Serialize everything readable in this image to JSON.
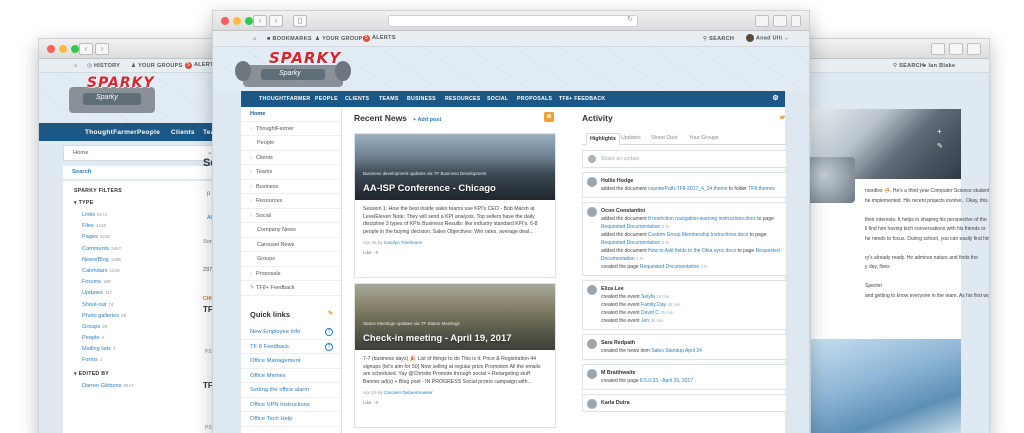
{
  "left_window": {
    "topbar": {
      "history": "HISTORY",
      "your_groups": "YOUR GROUPS",
      "alerts": "ALERTS",
      "alerts_count": "5"
    },
    "logo": {
      "title": "SPARKY",
      "subtitle": "Sparky"
    },
    "nav": [
      "ThoughtFarmer",
      "People",
      "Clients",
      "Tea"
    ],
    "home_dropdown": "Home",
    "search": "Search",
    "filters_title": "SPARKY FILTERS",
    "type_title": "TYPE",
    "filters": [
      {
        "label": "Links",
        "count": "8171"
      },
      {
        "label": "Files",
        "count": "4148"
      },
      {
        "label": "Pages",
        "count": "3232"
      },
      {
        "label": "Comments",
        "count": "2457"
      },
      {
        "label": "News/Blog",
        "count": "1385"
      },
      {
        "label": "Calendars",
        "count": "1249"
      },
      {
        "label": "Forums",
        "count": "188"
      },
      {
        "label": "Updates",
        "count": "117"
      },
      {
        "label": "Shout-out",
        "count": "74"
      },
      {
        "label": "Photo galleries",
        "count": "59"
      },
      {
        "label": "Groups",
        "count": "28"
      },
      {
        "label": "People",
        "count": "4"
      },
      {
        "label": "Mailing lists",
        "count": "3"
      },
      {
        "label": "Forms",
        "count": "1"
      }
    ],
    "edited_by_title": "EDITED BY",
    "edited_by": {
      "label": "Darren Gibbons",
      "count": "8517"
    },
    "partial": {
      "se": "Se",
      "p": "p",
      "all": "All",
      "sort": "Sort",
      "num": "237",
      "chi": "CHI",
      "tf1": "TF",
      "tf2": "TF",
      "ps": "PS"
    }
  },
  "main_window": {
    "topbar": {
      "bookmarks": "BOOKMARKS",
      "your_groups": "YOUR GROUPS",
      "alerts": "ALERTS",
      "alerts_count": "5",
      "search": "SEARCH",
      "user": "Anad Ulli"
    },
    "logo": {
      "title": "SPARKY",
      "subtitle": "Sparky"
    },
    "nav": [
      "THOUGHTFARMER",
      "PEOPLE",
      "CLIENTS",
      "TEAMS",
      "BUSINESS",
      "RESOURCES",
      "SOCIAL",
      "PROPOSALS",
      "TF8+ FEEDBACK"
    ],
    "menu": [
      {
        "label": "Home",
        "level": 0,
        "chev": "",
        "active": true
      },
      {
        "label": "ThoughtFarmer",
        "level": 0,
        "chev": "›"
      },
      {
        "label": "People",
        "level": 1,
        "chev": ""
      },
      {
        "label": "Clients",
        "level": 0,
        "chev": "›"
      },
      {
        "label": "Teams",
        "level": 0,
        "chev": "›"
      },
      {
        "label": "Business",
        "level": 0,
        "chev": "›"
      },
      {
        "label": "Resources",
        "level": 0,
        "chev": "›"
      },
      {
        "label": "Social",
        "level": 0,
        "chev": "›"
      },
      {
        "label": "Company News",
        "level": 1,
        "chev": ""
      },
      {
        "label": "Carousel News",
        "level": 1,
        "chev": ""
      },
      {
        "label": "Groups",
        "level": 1,
        "chev": ""
      },
      {
        "label": "Proposals",
        "level": 0,
        "chev": "›"
      },
      {
        "label": "TF8+ Feedback",
        "level": 0,
        "chev": "✎"
      }
    ],
    "quick_links_title": "Quick links",
    "quick_links": [
      {
        "label": "New Employee Info",
        "help": "?"
      },
      {
        "label": "TF 8 Feedback",
        "help": "?"
      },
      {
        "label": "Office Management",
        "help": ""
      },
      {
        "label": "Office Memes",
        "help": ""
      },
      {
        "label": "Setting the office alarm",
        "help": ""
      },
      {
        "label": "Office VPN Instructions",
        "help": ""
      },
      {
        "label": "Office Tech Help",
        "help": ""
      }
    ],
    "news": {
      "title": "Recent News",
      "add_post": "+ Add post",
      "items": [
        {
          "subtitle": "Business development updates via TF Business Development",
          "title": "AA-ISP Conference - Chicago",
          "body": "Session 1: How the best inside sales teams use KPI's CEO - Bob Marsh at LevelEleven Note: They will send a KPI analysis. Top sellers have the daily discipline 3 types of KPIs Business Results: like industry standard KPI's. 6-8 people in the buying decision. Sales Objectives: Win rates, average deal...",
          "date": "Apr 26 by",
          "author": "Carolyn Tinelmann",
          "likes": "Like · 0"
        },
        {
          "subtitle": "Status Meetings updates via TF Status Meetings",
          "title": "Check-in meeting - April 19, 2017",
          "body": "7-7 (business days) 🎉 List of things to do This is it. Price & Registration 44 signups (let's aim for 50) Now selling at regular price Promotion All the emails are scheduled. Yay @Christie Promote through social + Retargeting stuff Banner ad(s) + Blog post - IN PROGRESS Social promo campaign with...",
          "date": "Apr 19 by",
          "author": "Carolien Debeermaeker",
          "likes": "Like · 0"
        }
      ]
    },
    "activity": {
      "title": "Activity",
      "tabs": [
        "Highlights",
        "Updates",
        "Shout Outs",
        "Your Groups"
      ],
      "share_placeholder": "Share an update",
      "items": [
        {
          "name": "Hollie Hodge",
          "lines": [
            {
              "text": "added the document ",
              "link": "counterPath-TF8-2017_4_24.theme",
              "rest": " to folder ",
              "link2": "TF8 themes",
              "time": ""
            }
          ]
        },
        {
          "name": "Ocon Constantini",
          "lines": [
            {
              "text": "added the document ",
              "link": "tf restriction navigation-warning instructions.docx",
              "rest": " to page ",
              "link2": "Requested Documentation",
              "time": "3 hr"
            },
            {
              "text": "added the document ",
              "link": "Custom Group Membership Instructions.docx",
              "rest": " to page ",
              "link2": "Requested Documentation",
              "time": "3 hr"
            },
            {
              "text": "added the document ",
              "link": "How to Add fields to the Okta sync.docx",
              "rest": " to page ",
              "link2": "Requested Documentation",
              "time": "3 hr"
            },
            {
              "text": "created the page ",
              "link": "Requested Documentation",
              "rest": "",
              "link2": "",
              "time": "3 hr"
            }
          ]
        },
        {
          "name": "Eliza Lee",
          "lines": [
            {
              "text": "created the event ",
              "link": "Seiyfa",
              "rest": "",
              "link2": "",
              "time": "25 min"
            },
            {
              "text": "created the event ",
              "link": "Family Day",
              "rest": "",
              "link2": "",
              "time": "35 min"
            },
            {
              "text": "created the event ",
              "link": "David C",
              "rest": "",
              "link2": "",
              "time": "36 min"
            },
            {
              "text": "created the event ",
              "link": "Jen",
              "rest": "",
              "link2": "",
              "time": "36 min"
            }
          ]
        },
        {
          "name": "Sara Redpath",
          "lines": [
            {
              "text": "created the news item ",
              "link": "Sales Standup April 24",
              "rest": "",
              "link2": "",
              "time": ""
            }
          ]
        },
        {
          "name": "M Braithwaite",
          "lines": [
            {
              "text": "created the page ",
              "link": "8.5.0.33 - April 26, 2017",
              "rest": "",
              "link2": "",
              "time": ""
            }
          ]
        },
        {
          "name": "Karla Dutra",
          "lines": []
        }
      ]
    }
  },
  "right_window": {
    "topbar": {
      "search": "SEARCH",
      "user": "Ian Blake"
    },
    "bio": [
      "noodles 🍜. He's a third year Computer Science student",
      "be implemented. His recent projects involve.. Okay, this",
      "",
      "their interests. It helps in shaping his perspective of the",
      "ll find him having tech conversations with his friends or",
      "he needs to focus. During school, you can easily find him",
      "",
      "ry's already ready. He admires nature and finds the",
      "y day, fixes",
      "",
      "Specter",
      "and getting to know everyone in the team. As his first work"
    ]
  }
}
